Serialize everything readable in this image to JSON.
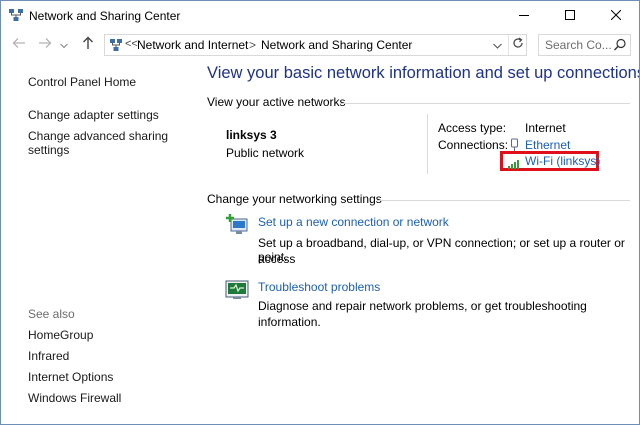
{
  "window": {
    "title": "Network and Sharing Center"
  },
  "address": {
    "overflow": "<<",
    "crumbs": [
      "Network and Internet",
      "Network and Sharing Center"
    ],
    "separator": ">"
  },
  "search": {
    "placeholder": "Search Co..."
  },
  "left_pane": {
    "links": [
      "Control Panel Home",
      "Change adapter settings",
      "Change advanced sharing",
      "settings"
    ],
    "see_also_label": "See also",
    "see_also": [
      "HomeGroup",
      "Infrared",
      "Internet Options",
      "Windows Firewall"
    ]
  },
  "main": {
    "heading": "View your basic network information and set up connections",
    "active_networks": {
      "title": "View your active networks",
      "network_name": "linksys  3",
      "network_type": "Public network",
      "access_type_label": "Access type:",
      "access_type_value": "Internet",
      "connections_label": "Connections:",
      "connection_1": "Ethernet",
      "connection_2": "Wi-Fi (linksys)"
    },
    "change_settings": {
      "title": "Change your networking settings",
      "items": [
        {
          "link": "Set up a new connection or network",
          "desc_line1": "Set up a broadband, dial-up, or VPN connection; or set up a router or access",
          "desc_line2": "point."
        },
        {
          "link": "Troubleshoot problems",
          "desc_line1": "Diagnose and repair network problems, or get troubleshooting information."
        }
      ]
    }
  },
  "colors": {
    "heading": "#1e3287",
    "link": "#1a5fb4",
    "highlight": "#e0101a"
  }
}
